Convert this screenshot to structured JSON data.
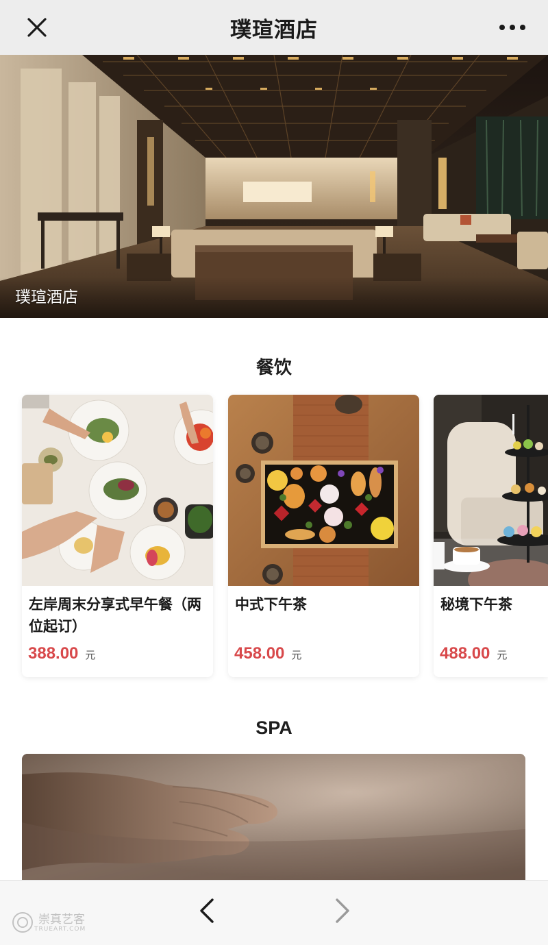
{
  "header": {
    "title": "璞瑄酒店",
    "close_icon": "close-icon",
    "more_icon": "more-dots-icon"
  },
  "hero": {
    "caption": "璞瑄酒店"
  },
  "dining": {
    "section_title": "餐饮",
    "items": [
      {
        "name": "左岸周末分享式早午餐（两位起订）",
        "price": "388.00",
        "unit": "元"
      },
      {
        "name": "中式下午茶",
        "price": "458.00",
        "unit": "元"
      },
      {
        "name": "秘境下午茶",
        "price": "488.00",
        "unit": "元"
      }
    ]
  },
  "spa": {
    "section_title": "SPA"
  },
  "bottom_nav": {
    "back_icon": "chevron-left-icon",
    "forward_icon": "chevron-right-icon",
    "watermark_text": "崇真艺客",
    "watermark_sub": "TRUEART.COM"
  },
  "colors": {
    "price": "#d8494b",
    "topbar_bg": "#ededed",
    "bottombar_bg": "#f7f7f7"
  }
}
